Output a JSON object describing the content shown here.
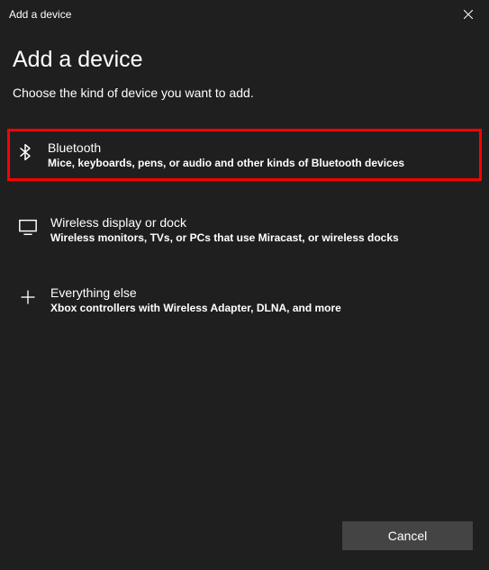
{
  "titlebar": {
    "title": "Add a device"
  },
  "heading": "Add a device",
  "subheading": "Choose the kind of device you want to add.",
  "options": {
    "bluetooth": {
      "title": "Bluetooth",
      "desc": "Mice, keyboards, pens, or audio and other kinds of Bluetooth devices"
    },
    "wireless": {
      "title": "Wireless display or dock",
      "desc": "Wireless monitors, TVs, or PCs that use Miracast, or wireless docks"
    },
    "everything": {
      "title": "Everything else",
      "desc": "Xbox controllers with Wireless Adapter, DLNA, and more"
    }
  },
  "footer": {
    "cancel_label": "Cancel"
  }
}
